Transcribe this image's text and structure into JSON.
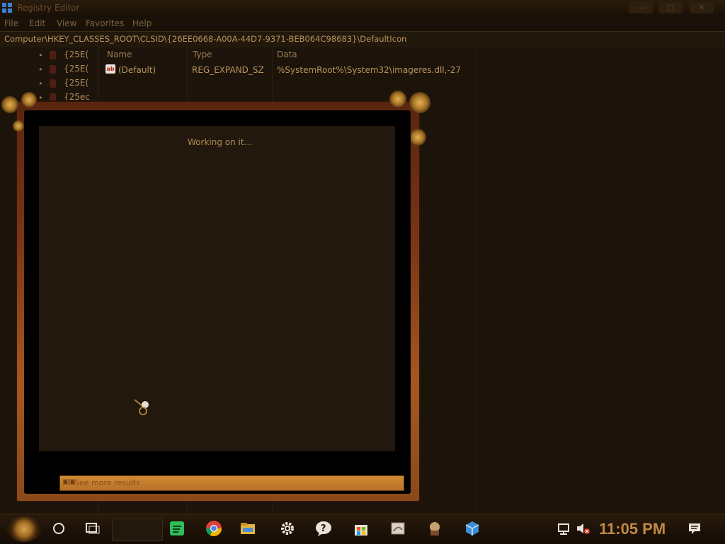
{
  "window": {
    "title": "Registry Editor",
    "minimize": "—",
    "maximize": "□",
    "close": "✕"
  },
  "menu": [
    "File",
    "Edit",
    "View",
    "Favorites",
    "Help"
  ],
  "address": "Computer\\HKEY_CLASSES_ROOT\\CLSID\\{26EE0668-A00A-44D7-9371-BEB064C98683}\\DefaultIcon",
  "tree": {
    "items": [
      "{25E(",
      "{25E(",
      "{25E(",
      "{25ec"
    ]
  },
  "list": {
    "headers": {
      "name": "Name",
      "type": "Type",
      "data": "Data"
    },
    "rows": [
      {
        "icon": "ab",
        "name": "(Default)",
        "type": "REG_EXPAND_SZ",
        "data": "%SystemRoot%\\System32\\imageres.dll,-27"
      }
    ]
  },
  "search_panel": {
    "status": "Working on it...",
    "see_more": "See more results"
  },
  "taskbar": {
    "clock": "11:05 PM",
    "icons": [
      "start-orb-icon",
      "cortana-circle-icon",
      "task-view-icon",
      "spotify-icon",
      "chrome-icon",
      "file-explorer-icon",
      "settings-gear-icon",
      "help-icon",
      "store-icon",
      "paint-icon",
      "app-icon",
      "3d-box-icon"
    ],
    "tray": [
      "network-icon",
      "volume-muted-icon",
      "notification-icon"
    ]
  },
  "colors": {
    "accent": "#c08a45",
    "panel_frame": "#7a3515",
    "background": "#1e1409"
  }
}
